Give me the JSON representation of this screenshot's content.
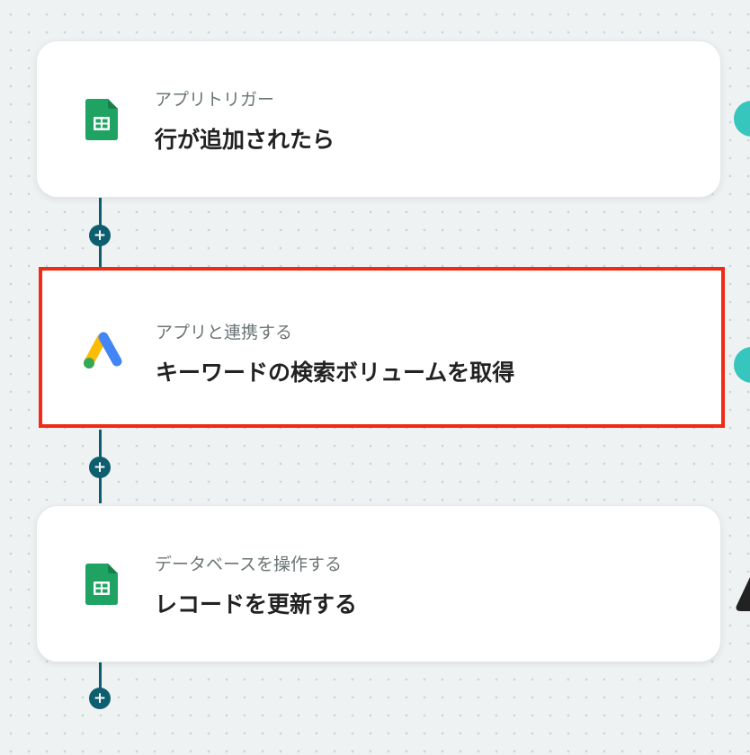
{
  "flow": {
    "steps": [
      {
        "subtitle": "アプリトリガー",
        "title": "行が追加されたら",
        "icon": "google-sheets-icon",
        "highlighted": false
      },
      {
        "subtitle": "アプリと連携する",
        "title": "キーワードの検索ボリュームを取得",
        "icon": "google-ads-icon",
        "highlighted": true
      },
      {
        "subtitle": "データベースを操作する",
        "title": "レコードを更新する",
        "icon": "google-sheets-icon",
        "highlighted": false
      }
    ],
    "add_step_symbol": "+"
  },
  "colors": {
    "background": "#eef2f2",
    "connector": "#0d5e6e",
    "highlight_border": "#f02a14",
    "sheets_green": "#1ea362",
    "edge_teal": "#37c6bd"
  }
}
